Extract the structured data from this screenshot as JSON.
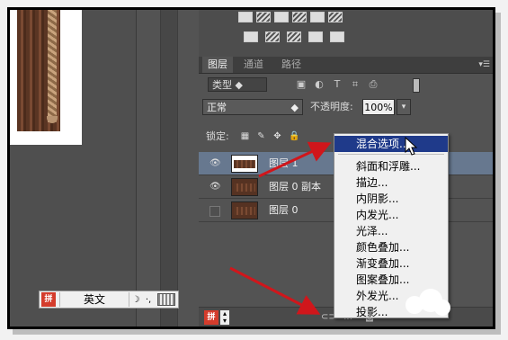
{
  "layers_panel": {
    "tabs": [
      "图层",
      "通道",
      "路径"
    ],
    "filter_label": "类型",
    "blend_mode": "正常",
    "opacity_label": "不透明度:",
    "opacity_value": "100%",
    "lock_label": "锁定:",
    "layers": [
      {
        "name": "图层 1",
        "selected": true,
        "visible": true
      },
      {
        "name": "图层 0 副本",
        "selected": false,
        "visible": true
      },
      {
        "name": "图层 0",
        "selected": false,
        "visible": false
      }
    ],
    "bottom_icons": [
      "link-icon",
      "fx-icon",
      "mask-icon"
    ]
  },
  "context_menu": {
    "items": [
      "混合选项...",
      "斜面和浮雕...",
      "描边...",
      "内阴影...",
      "内发光...",
      "光泽...",
      "颜色叠加...",
      "渐变叠加...",
      "图案叠加...",
      "外发光...",
      "投影..."
    ],
    "highlighted_index": 0
  },
  "ime_bar": {
    "language": "英文"
  },
  "colors": {
    "selected_layer": "#67788f",
    "menu_highlight": "#1f3a8a",
    "annotation_arrow": "#d0161b"
  }
}
